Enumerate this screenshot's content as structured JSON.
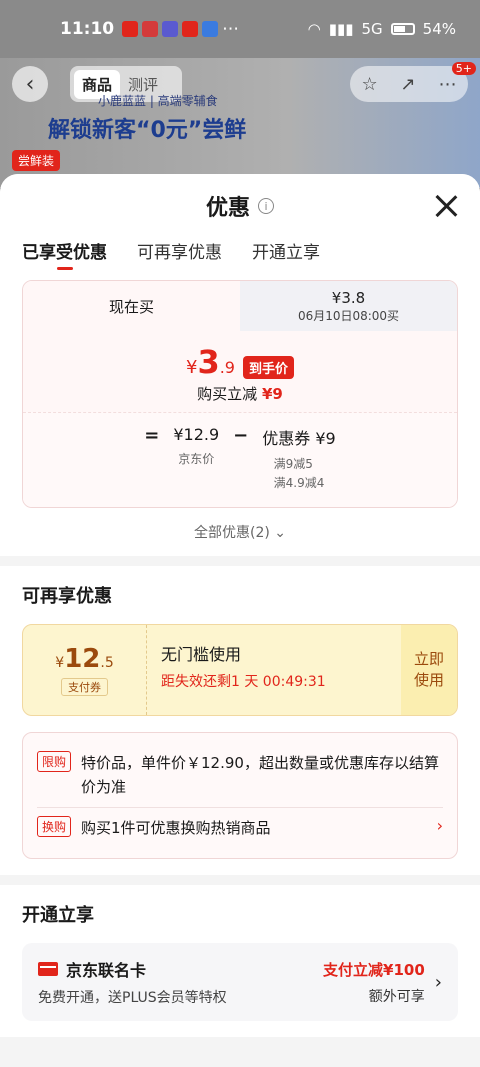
{
  "status_bar": {
    "time": "11:10",
    "network": "5G",
    "battery": "54%"
  },
  "background": {
    "tab_goods": "商品",
    "tab_review": "测评",
    "badge": "5+",
    "promo_line1": "小鹿蓝蓝 | 高端零辅食",
    "promo_line2": "解锁新客“0元”尝鲜",
    "promo_tag": "尝鲜装"
  },
  "sheet": {
    "title": "优惠",
    "tabs": [
      "已享受优惠",
      "可再享优惠",
      "开通立享"
    ],
    "price_card": {
      "tab_now": "现在买",
      "tab_later_price": "¥3.8",
      "tab_later_time": "06月10日08:00买",
      "currency": "¥",
      "price_int": "3",
      "price_dec": ".9",
      "final_tag": "到手价",
      "reduce_label": "购买立减",
      "reduce_amount": "¥9",
      "eq": "=",
      "minus": "−",
      "jd_price": "¥12.9",
      "jd_price_label": "京东价",
      "coupon_label": "优惠券 ¥9",
      "coupon_rule1": "满9减5",
      "coupon_rule2": "满4.9减4"
    },
    "all_discounts": "全部优惠(2)"
  },
  "more_discounts": {
    "title": "可再享优惠",
    "coupon": {
      "currency": "¥",
      "amount": "12",
      "amount_dec": ".5",
      "type": "支付券",
      "desc": "无门槛使用",
      "expiry": "距失效还剩1 天 00:49:31",
      "action": "立即\n使用"
    },
    "rules": [
      {
        "badge": "限购",
        "text": "特价品，单件价￥12.90，超出数量或优惠库存以结算价为准"
      },
      {
        "badge": "换购",
        "text": "购买1件可优惠换购热销商品"
      }
    ]
  },
  "open_enjoy": {
    "title": "开通立享",
    "card_name": "京东联名卡",
    "card_desc": "免费开通，送PLUS会员等特权",
    "offer": "支付立减¥100",
    "offer_note": "额外可享"
  }
}
